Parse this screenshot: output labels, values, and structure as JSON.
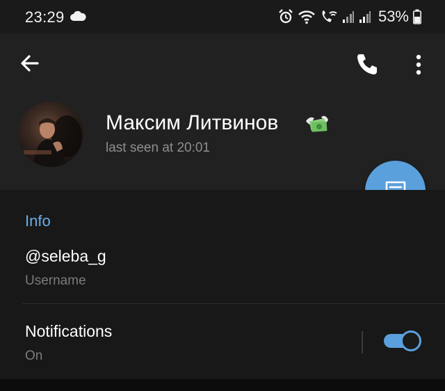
{
  "status_bar": {
    "time": "23:29",
    "battery_percent": "53%",
    "icons": [
      "cloud-icon",
      "alarm-icon",
      "wifi-icon",
      "wifi-call-icon",
      "signal-icon",
      "signal-icon",
      "battery-icon"
    ]
  },
  "appbar": {
    "icons": [
      "back-arrow-icon",
      "phone-call-icon",
      "more-vertical-icon"
    ]
  },
  "profile": {
    "name": "Максим Литвинов",
    "status": "last seen at 20:01",
    "emoji": "money-with-wings-icon"
  },
  "fab": {
    "icon": "message-icon"
  },
  "info_section": {
    "title": "Info",
    "username": "@seleba_g",
    "username_label": "Username",
    "notifications_label": "Notifications",
    "notifications_value": "On",
    "notifications_enabled": true
  },
  "colors": {
    "accent": "#5aa0dd",
    "section_title": "#6aaee6",
    "header_bg": "#212121",
    "body_bg": "#181818"
  }
}
